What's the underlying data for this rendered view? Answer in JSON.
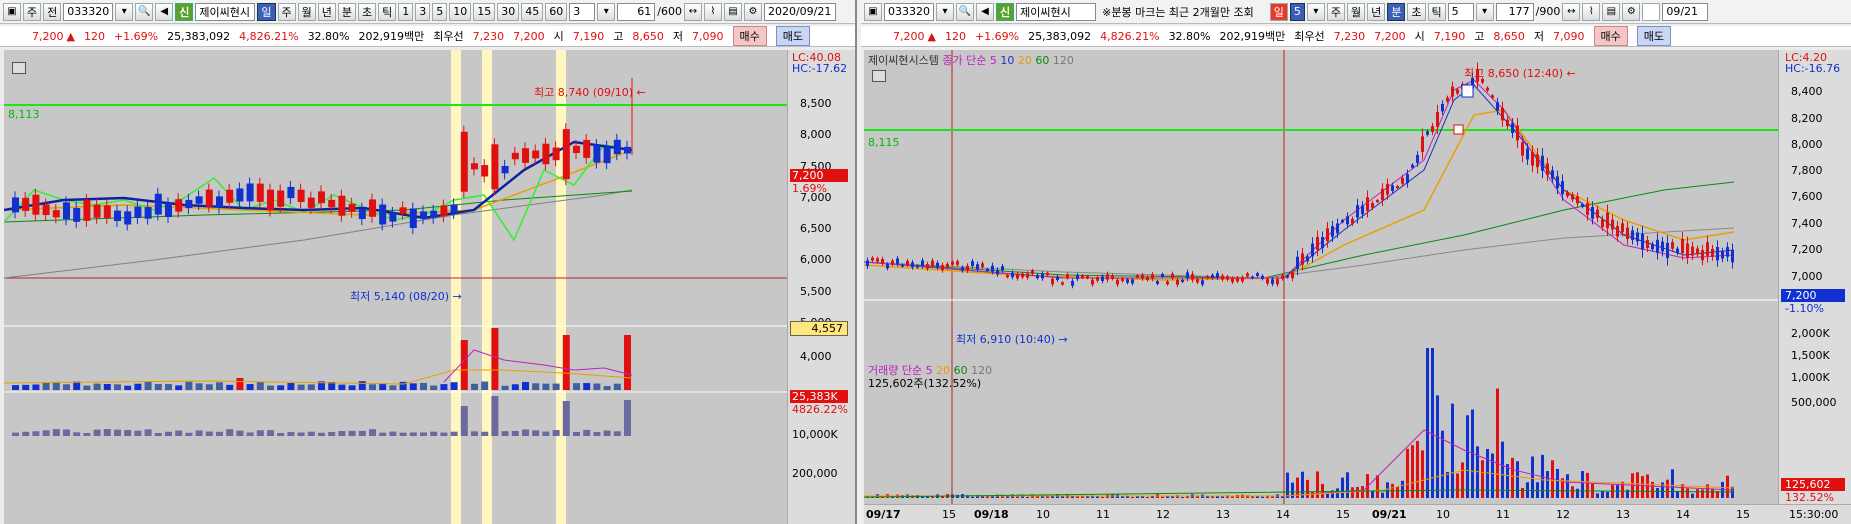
{
  "left": {
    "toolbar": {
      "market": "주",
      "type": "전",
      "code": "033320",
      "cond": "신",
      "name": "제이씨현시",
      "periods": [
        "일",
        "주",
        "월",
        "년",
        "분",
        "초",
        "틱"
      ],
      "minutes": [
        "1",
        "3",
        "5",
        "10",
        "15",
        "30",
        "45",
        "60"
      ],
      "n_value": "3",
      "count": "61",
      "count_total": "/600",
      "date": "2020/09/21"
    },
    "quote": {
      "price": "7,200",
      "arrow": "▲",
      "change": "120",
      "pct": "+1.69%",
      "volume": "25,383,092",
      "vol_ratio": "4,826.21%",
      "turnover": "32.80%",
      "amount": "202,919백만",
      "bid_label": "최우선",
      "bid1": "7,230",
      "bid2": "7,200",
      "open_label": "시",
      "open": "7,190",
      "high_label": "고",
      "high": "8,650",
      "low_label": "저",
      "low": "7,090",
      "buy": "매수",
      "sell": "매도"
    },
    "chart_text": {
      "lc": "LC:40.08",
      "hc": "HC:-17.62",
      "level": "8,113",
      "max_note": "최고 8,740 (09/10) ←",
      "min_note": "최저 5,140 (08/20) →",
      "price_tag": "7,200",
      "price_pct": "1.69%",
      "cursor_tag": "4,557",
      "vol_tag": "25,383K",
      "vol_pct": "4826.22%",
      "vol_axis": "10,000K",
      "sub_axis": "200,000"
    },
    "price_ticks": [
      "8,500",
      "8,000",
      "7,500",
      "7,000",
      "6,500",
      "6,000",
      "5,500",
      "5,000",
      "4,000"
    ]
  },
  "right": {
    "toolbar": {
      "code": "033320",
      "cond": "신",
      "name": "제이씨현시",
      "notice": "※분봉 마크는 최근 2개월만 조회",
      "periods": [
        "일",
        "5",
        "주",
        "월",
        "년",
        "분",
        "초",
        "틱"
      ],
      "tick_value": "5",
      "count": "177",
      "count_total": "/900",
      "date": "09/21"
    },
    "quote": {
      "price": "7,200",
      "arrow": "▲",
      "change": "120",
      "pct": "+1.69%",
      "volume": "25,383,092",
      "vol_ratio": "4,826.21%",
      "turnover": "32.80%",
      "amount": "202,919백만",
      "bid_label": "최우선",
      "bid1": "7,230",
      "bid2": "7,200",
      "open_label": "시",
      "open": "7,190",
      "high_label": "고",
      "high": "8,650",
      "low_label": "저",
      "low": "7,090",
      "buy": "매수",
      "sell": "매도"
    },
    "chart_text": {
      "legend_name": "제이씨현시스템",
      "legend_ma": "종가 단순 5",
      "ma10": "10",
      "ma20": "20",
      "ma60": "60",
      "ma120": "120",
      "lc": "LC:4.20",
      "hc": "HC:-16.76",
      "level": "8,115",
      "max_note": "최고 8,650 (12:40) ←",
      "min_note": "최저 6,910 (10:40) →",
      "price_tag": "7,200",
      "price_pct": "-1.10%",
      "vol_legend": "거래량 단순 5",
      "vol_20": "20",
      "vol_60": "60",
      "vol_120": "120",
      "vol_line": "125,602주(132.52%)",
      "vol_tag": "125,602",
      "vol_pct": "132.52%",
      "time_corner": "15:30:00"
    },
    "price_ticks": [
      "8,400",
      "8,200",
      "8,000",
      "7,800",
      "7,600",
      "7,400",
      "7,200",
      "7,000"
    ],
    "vol_ticks": [
      "2,000K",
      "1,500K",
      "1,000K",
      "500,000"
    ],
    "x_ticks": [
      "09/17",
      "15",
      "09/18",
      "10",
      "11",
      "12",
      "13",
      "14",
      "15",
      "09/21",
      "10",
      "11",
      "12",
      "13",
      "14",
      "15"
    ]
  },
  "colors": {
    "up": "#e01010",
    "down": "#1030d0",
    "level_line": "#19e619",
    "highlight": "#fff6c0"
  }
}
